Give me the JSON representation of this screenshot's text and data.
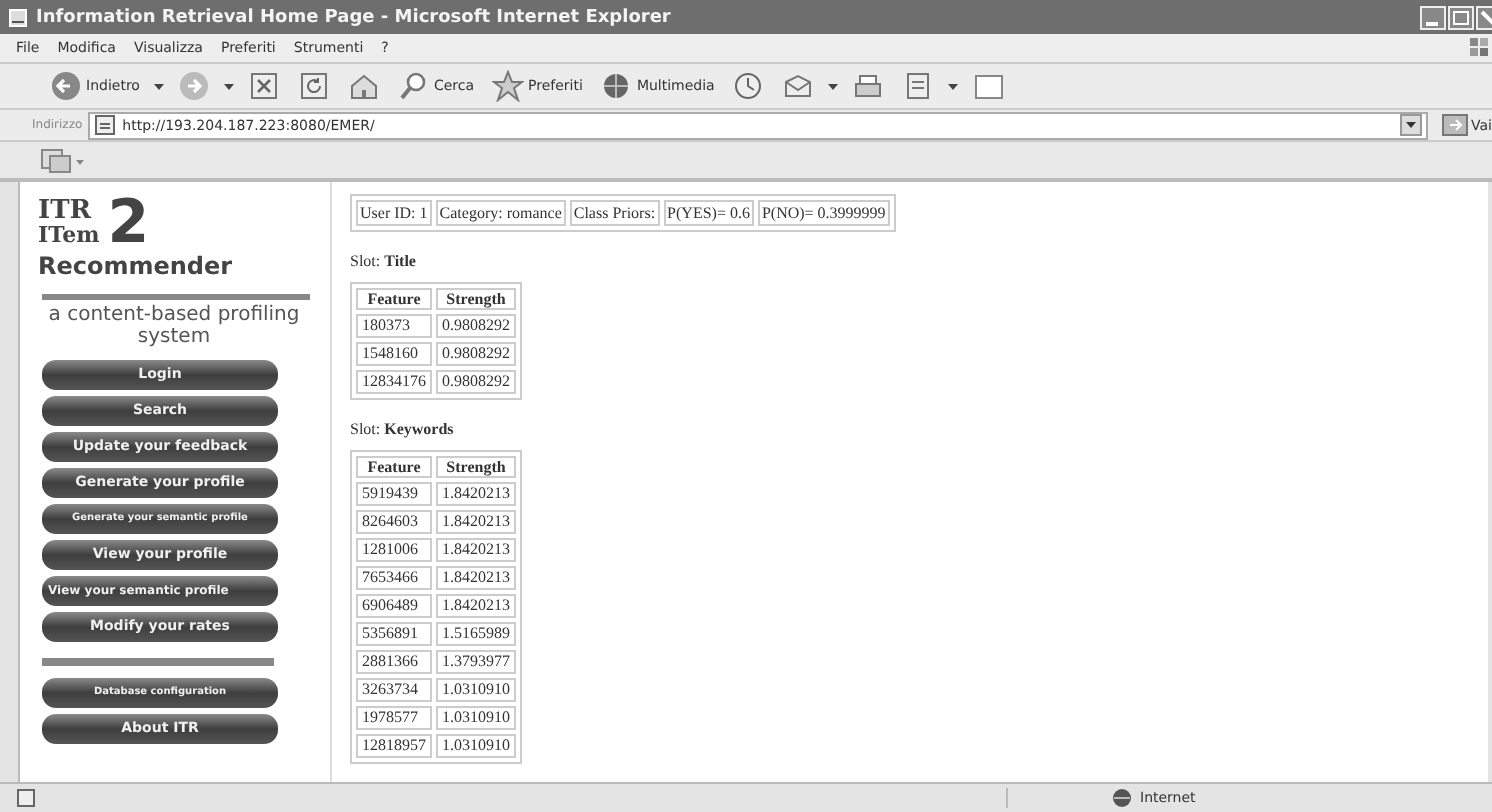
{
  "window": {
    "title": "Information Retrieval Home Page - Microsoft Internet Explorer"
  },
  "menu": [
    "File",
    "Modifica",
    "Visualizza",
    "Preferiti",
    "Strumenti",
    "?"
  ],
  "toolbar": [
    {
      "kind": "back",
      "label": "Indietro"
    },
    {
      "kind": "forward"
    },
    {
      "kind": "stop"
    },
    {
      "kind": "refresh"
    },
    {
      "kind": "home"
    },
    {
      "kind": "search",
      "label": "Cerca"
    },
    {
      "kind": "favorites",
      "label": "Preferiti"
    },
    {
      "kind": "media",
      "label": "Multimedia"
    },
    {
      "kind": "history"
    },
    {
      "kind": "mail"
    },
    {
      "kind": "print"
    },
    {
      "kind": "edit"
    },
    {
      "kind": "discuss"
    }
  ],
  "address": {
    "label": "Indirizzo",
    "url": "http://193.204.187.223:8080/EMER/",
    "go": "Vai"
  },
  "sidebar": {
    "logo": {
      "name": "ITR",
      "version": "2",
      "line1": "ITem",
      "line2": "Recommender"
    },
    "tagline": "a content-based profiling system",
    "groups": [
      [
        {
          "label": "Login",
          "kind": "large"
        },
        {
          "label": "Search",
          "kind": "large"
        },
        {
          "label": "Update your feedback",
          "kind": "large"
        },
        {
          "label": "Generate your profile",
          "kind": "large"
        },
        {
          "label": "Generate your semantic profile",
          "kind": "small"
        },
        {
          "label": "View your profile",
          "kind": "large"
        },
        {
          "label": "View your semantic profile",
          "kind": "medium"
        },
        {
          "label": "Modify your rates",
          "kind": "large"
        }
      ],
      [
        {
          "label": "Database configuration",
          "kind": "small"
        },
        {
          "label": "About ITR",
          "kind": "large"
        }
      ]
    ]
  },
  "info": [
    "User ID: 1",
    "Category: romance",
    "Class Priors:",
    "P(YES)= 0.6",
    "P(NO)= 0.3999999"
  ],
  "slots": [
    {
      "title": "Slot: **Title**",
      "columns": [
        "Feature",
        "Strength"
      ],
      "rows": [
        [
          "180373",
          "0.9808292"
        ],
        [
          "1548160",
          "0.9808292"
        ],
        [
          "12834176",
          "0.9808292"
        ]
      ]
    },
    {
      "title": "Slot: **Keywords**",
      "columns": [
        "Feature",
        "Strength"
      ],
      "rows": [
        [
          "5919439",
          "1.8420213"
        ],
        [
          "8264603",
          "1.8420213"
        ],
        [
          "1281006",
          "1.8420213"
        ],
        [
          "7653466",
          "1.8420213"
        ],
        [
          "6906489",
          "1.8420213"
        ],
        [
          "5356891",
          "1.5165989"
        ],
        [
          "2881366",
          "1.3793977"
        ],
        [
          "3263734",
          "1.0310910"
        ],
        [
          "1978577",
          "1.0310910"
        ],
        [
          "12818957",
          "1.0310910"
        ]
      ]
    }
  ],
  "status": {
    "zone": "Internet"
  }
}
